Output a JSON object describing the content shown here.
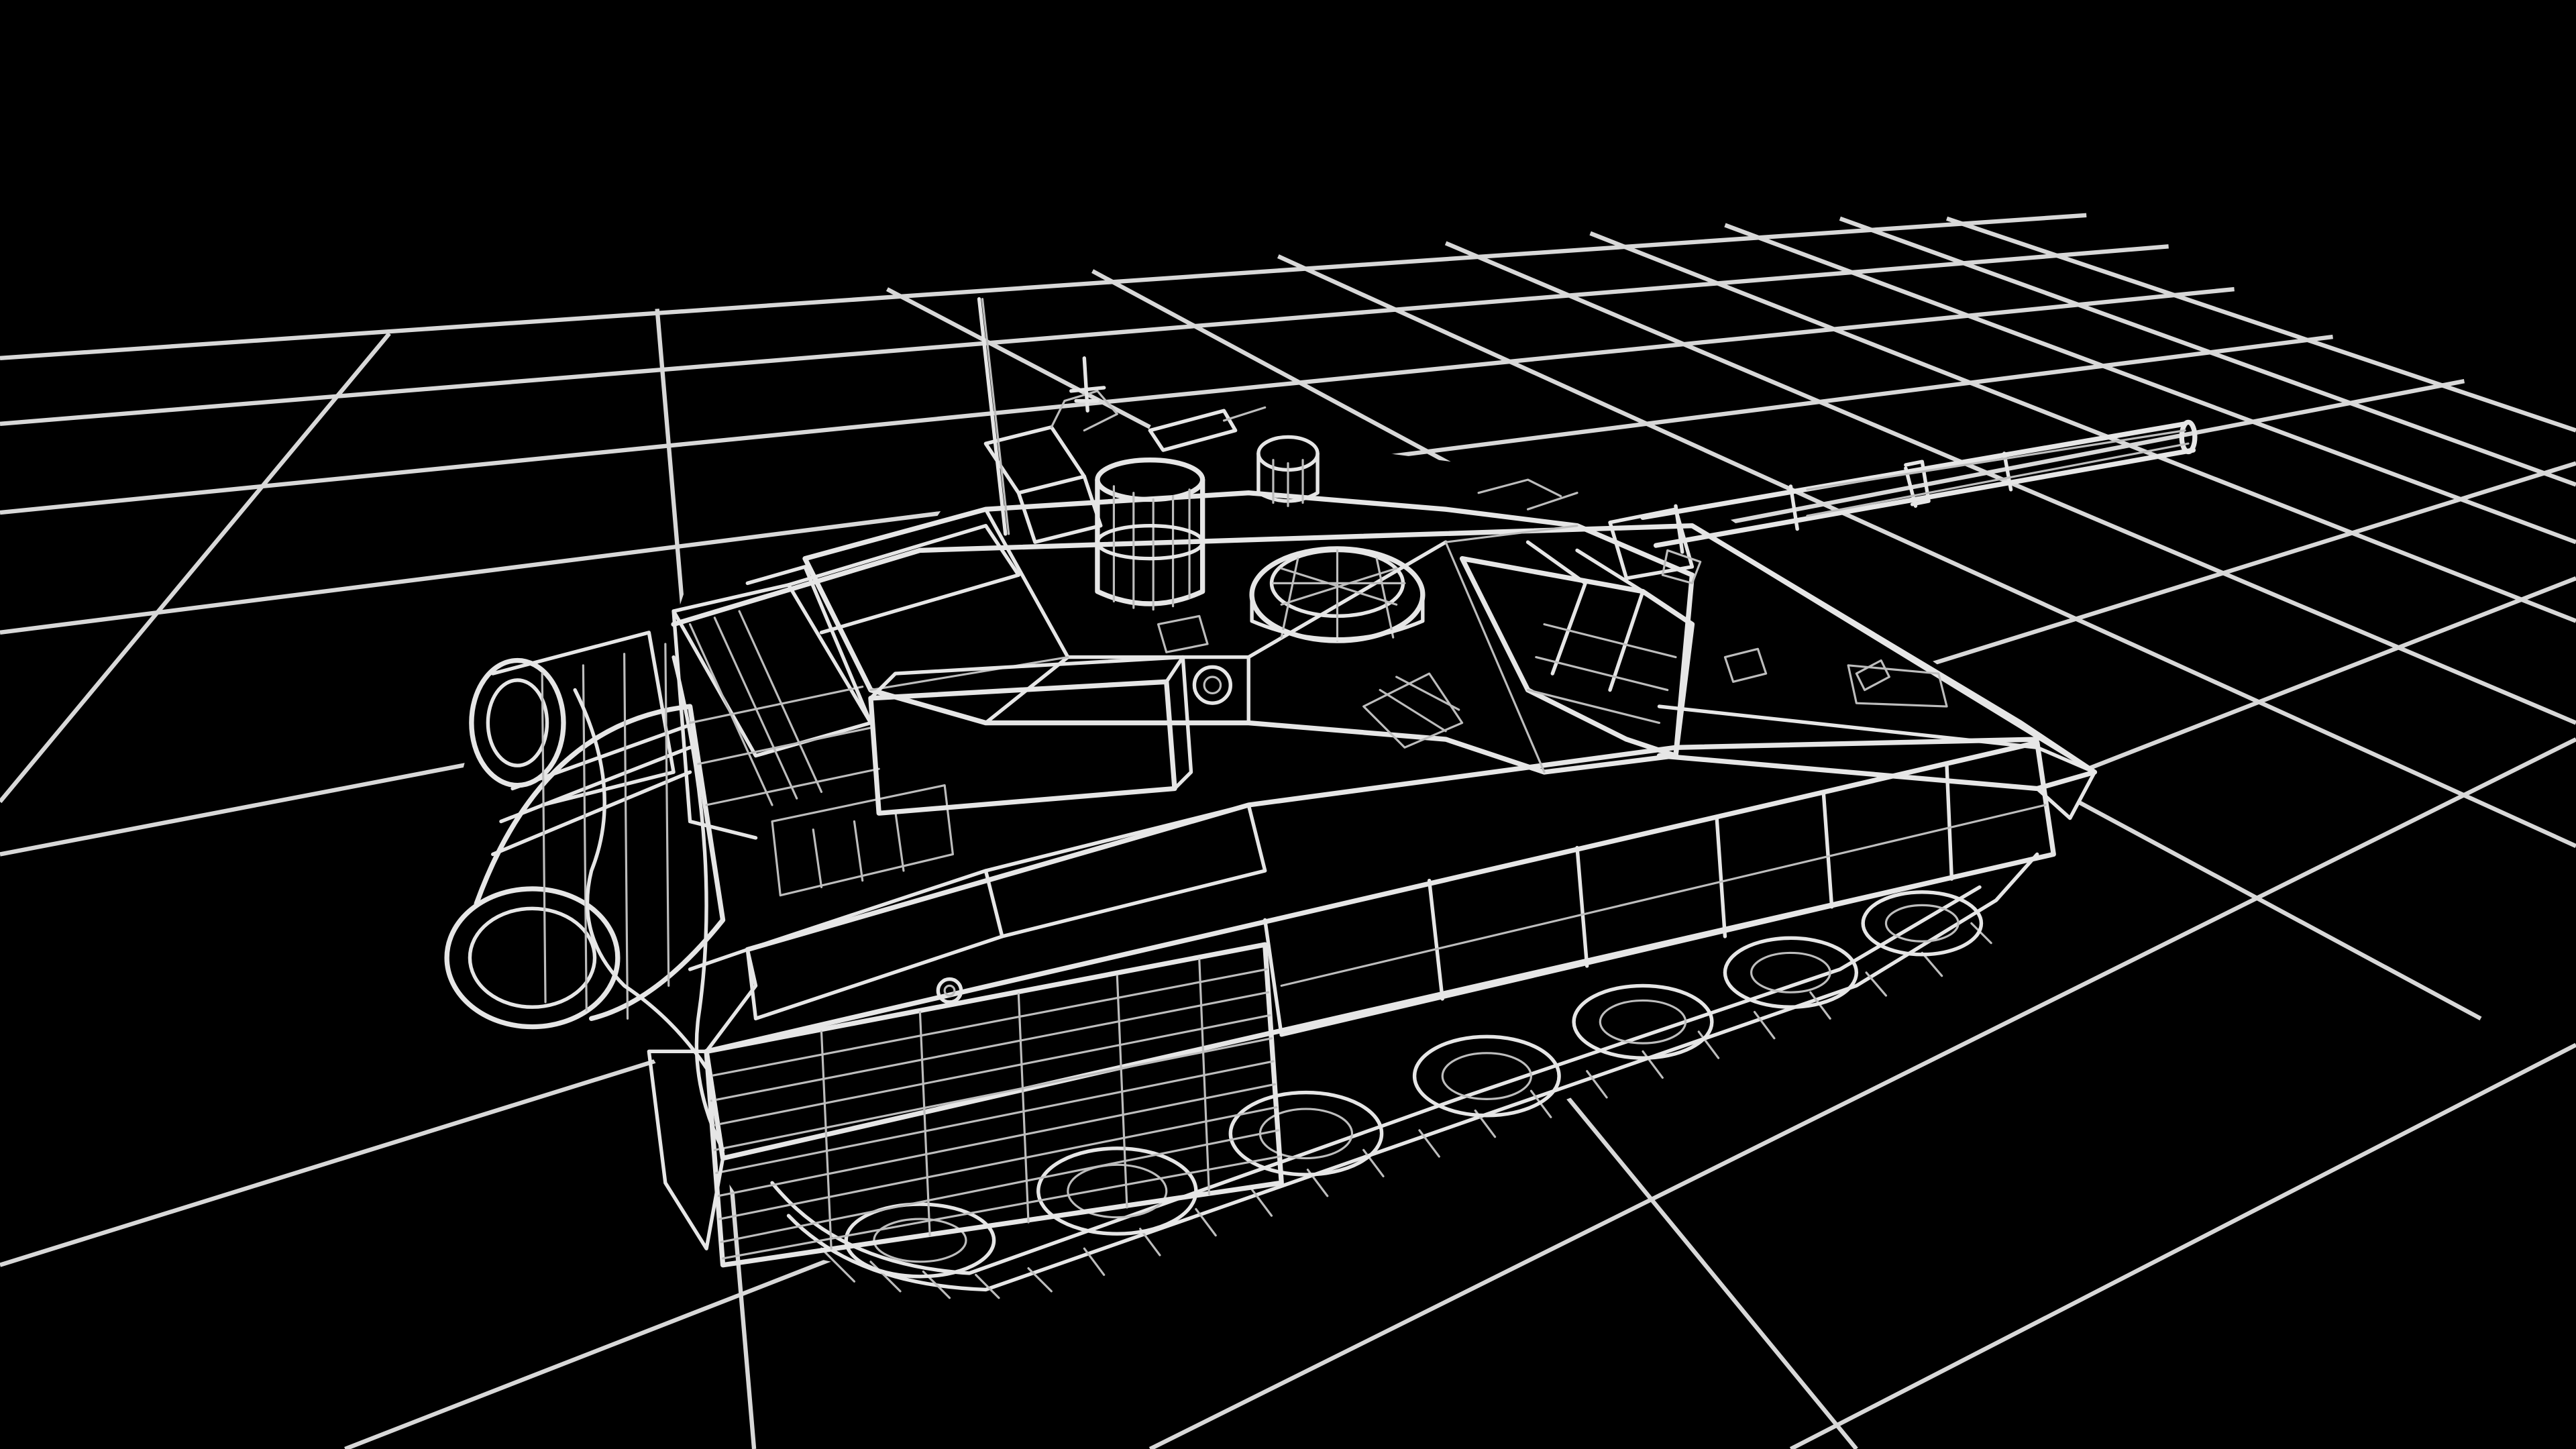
{
  "scene": {
    "subject": "tank-wireframe",
    "background_color": "#000000",
    "line_color": "#e6e6e6",
    "grid_color": "#d8d8d8",
    "render_style": "wireframe",
    "floor_grid": true
  }
}
